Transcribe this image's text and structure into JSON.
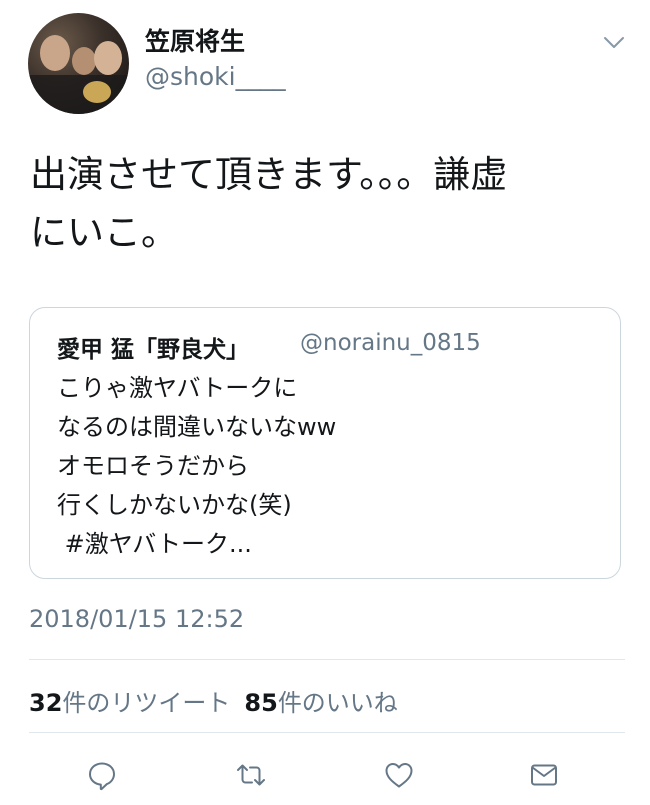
{
  "tweet": {
    "display_name": "笠原将生",
    "handle": "@shoki____",
    "text_line1": "出演させて頂きます。。。謙虚",
    "text_line2": "にいこ。",
    "timestamp": "2018/01/15 12:52"
  },
  "quoted_tweet": {
    "display_name": "愛甲 猛「野良犬」",
    "handle": "@norainu_0815",
    "lines": [
      "こりゃ激ヤバトークに",
      "なるのは間違いないなww",
      "オモロそうだから",
      "行くしかないかな(笑)",
      " #激ヤバトーク..."
    ]
  },
  "stats": {
    "retweet_count": "32",
    "retweet_label": "件のリツイート",
    "like_count": "85",
    "like_label": "件のいいね"
  },
  "icons": {
    "reply": "reply-icon",
    "retweet": "retweet-icon",
    "like": "heart-icon",
    "dm": "envelope-icon",
    "more": "chevron-down-icon"
  },
  "colors": {
    "text": "#14171a",
    "secondary": "#657786",
    "border": "#ccd6dd",
    "divider": "#e1e8ed"
  }
}
